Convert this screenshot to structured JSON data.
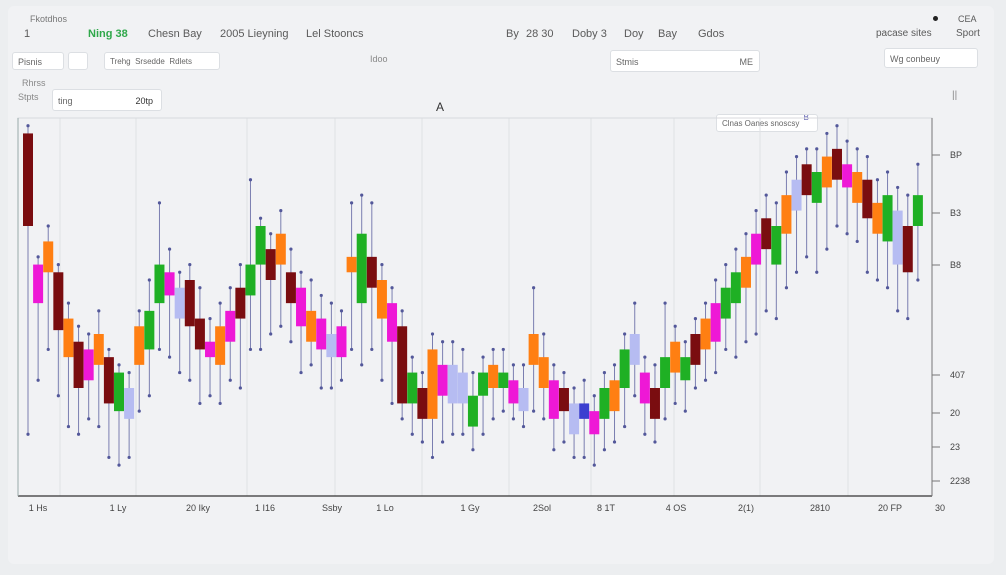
{
  "topbar": {
    "small_title": "Fkotdhos",
    "index": "1",
    "items": [
      "Ning 38",
      "Chesn Bay",
      "2005 Lieyning",
      "Lel Stooncs"
    ],
    "right_items": [
      "By",
      "28 30",
      "Doby 3",
      "Doy",
      "Bay",
      "Gdos"
    ],
    "far_right": [
      "CEA",
      "pacase sites",
      "Sport"
    ]
  },
  "toolbar": {
    "field1": "Pisnis",
    "field2": "",
    "field3": "Trehg",
    "field3b": "Srsedde",
    "field3c": "Rdlets",
    "center_label": "Idoo",
    "search_value": "Stmis",
    "search_suffix": "ME",
    "right_field": "Wg conbeuy",
    "sub1": "Rhrss",
    "sub2": "Stpts"
  },
  "chart_header": {
    "range_label": "ting",
    "range_value": "20tp",
    "marker": "A",
    "right_icon": "||",
    "legend_text": "Clnas Oanes snoscsy",
    "legend_icon": "B"
  },
  "colors": {
    "red": "#7a0d10",
    "orange": "#ff7f12",
    "green": "#1fb024",
    "magenta": "#ee18d6",
    "lightblue": "#b6bcf2",
    "wick": "#53589a"
  },
  "chart_data": {
    "type": "candlestick",
    "ylim": [
      2,
      100
    ],
    "y_ticks": [
      "BP",
      "B3",
      "B8",
      "407",
      "20",
      "23",
      "2238"
    ],
    "x_ticks": [
      "1 Hs",
      "1 Ly",
      "20 Iky",
      "1 I16",
      "Ssby",
      "1 Lo",
      "1 Gy",
      "2Sol",
      "8 1T",
      "4 OS",
      "2(1)",
      "2810",
      "20 FP",
      "30"
    ],
    "candles": [
      {
        "o": 96,
        "c": 72,
        "h": 98,
        "l": 18,
        "color": "red"
      },
      {
        "o": 62,
        "c": 52,
        "h": 64,
        "l": 32,
        "color": "magenta"
      },
      {
        "o": 68,
        "c": 60,
        "h": 72,
        "l": 40,
        "color": "orange"
      },
      {
        "o": 60,
        "c": 45,
        "h": 62,
        "l": 28,
        "color": "red"
      },
      {
        "o": 48,
        "c": 38,
        "h": 52,
        "l": 20,
        "color": "orange"
      },
      {
        "o": 42,
        "c": 30,
        "h": 46,
        "l": 18,
        "color": "red"
      },
      {
        "o": 40,
        "c": 32,
        "h": 44,
        "l": 22,
        "color": "magenta"
      },
      {
        "o": 44,
        "c": 36,
        "h": 50,
        "l": 20,
        "color": "orange"
      },
      {
        "o": 38,
        "c": 26,
        "h": 40,
        "l": 12,
        "color": "red"
      },
      {
        "o": 34,
        "c": 24,
        "h": 36,
        "l": 10,
        "color": "green"
      },
      {
        "o": 30,
        "c": 22,
        "h": 34,
        "l": 12,
        "color": "lightblue"
      },
      {
        "o": 46,
        "c": 36,
        "h": 50,
        "l": 24,
        "color": "orange"
      },
      {
        "o": 40,
        "c": 50,
        "h": 58,
        "l": 28,
        "color": "green"
      },
      {
        "o": 52,
        "c": 62,
        "h": 78,
        "l": 40,
        "color": "green"
      },
      {
        "o": 60,
        "c": 54,
        "h": 66,
        "l": 38,
        "color": "magenta"
      },
      {
        "o": 56,
        "c": 48,
        "h": 60,
        "l": 34,
        "color": "lightblue"
      },
      {
        "o": 58,
        "c": 46,
        "h": 62,
        "l": 32,
        "color": "red"
      },
      {
        "o": 48,
        "c": 40,
        "h": 56,
        "l": 26,
        "color": "red"
      },
      {
        "o": 42,
        "c": 38,
        "h": 48,
        "l": 28,
        "color": "magenta"
      },
      {
        "o": 46,
        "c": 36,
        "h": 52,
        "l": 26,
        "color": "orange"
      },
      {
        "o": 50,
        "c": 42,
        "h": 56,
        "l": 32,
        "color": "magenta"
      },
      {
        "o": 56,
        "c": 48,
        "h": 62,
        "l": 30,
        "color": "red"
      },
      {
        "o": 54,
        "c": 62,
        "h": 84,
        "l": 40,
        "color": "green"
      },
      {
        "o": 62,
        "c": 72,
        "h": 74,
        "l": 40,
        "color": "green"
      },
      {
        "o": 66,
        "c": 58,
        "h": 70,
        "l": 44,
        "color": "red"
      },
      {
        "o": 70,
        "c": 62,
        "h": 76,
        "l": 46,
        "color": "orange"
      },
      {
        "o": 60,
        "c": 52,
        "h": 66,
        "l": 42,
        "color": "red"
      },
      {
        "o": 56,
        "c": 46,
        "h": 60,
        "l": 34,
        "color": "magenta"
      },
      {
        "o": 50,
        "c": 42,
        "h": 58,
        "l": 36,
        "color": "orange"
      },
      {
        "o": 48,
        "c": 40,
        "h": 54,
        "l": 30,
        "color": "magenta"
      },
      {
        "o": 44,
        "c": 38,
        "h": 52,
        "l": 30,
        "color": "lightblue"
      },
      {
        "o": 46,
        "c": 38,
        "h": 50,
        "l": 32,
        "color": "magenta"
      },
      {
        "o": 60,
        "c": 64,
        "h": 78,
        "l": 40,
        "color": "orange"
      },
      {
        "o": 52,
        "c": 70,
        "h": 80,
        "l": 36,
        "color": "green"
      },
      {
        "o": 64,
        "c": 56,
        "h": 78,
        "l": 40,
        "color": "red"
      },
      {
        "o": 58,
        "c": 48,
        "h": 62,
        "l": 32,
        "color": "orange"
      },
      {
        "o": 52,
        "c": 42,
        "h": 56,
        "l": 26,
        "color": "magenta"
      },
      {
        "o": 46,
        "c": 26,
        "h": 50,
        "l": 22,
        "color": "red"
      },
      {
        "o": 34,
        "c": 26,
        "h": 38,
        "l": 18,
        "color": "green"
      },
      {
        "o": 30,
        "c": 22,
        "h": 34,
        "l": 16,
        "color": "red"
      },
      {
        "o": 40,
        "c": 22,
        "h": 44,
        "l": 12,
        "color": "orange"
      },
      {
        "o": 36,
        "c": 28,
        "h": 42,
        "l": 16,
        "color": "magenta"
      },
      {
        "o": 36,
        "c": 26,
        "h": 42,
        "l": 18,
        "color": "lightblue"
      },
      {
        "o": 34,
        "c": 26,
        "h": 40,
        "l": 18,
        "color": "lightblue"
      },
      {
        "o": 28,
        "c": 20,
        "h": 34,
        "l": 14,
        "color": "green"
      },
      {
        "o": 34,
        "c": 28,
        "h": 38,
        "l": 18,
        "color": "green"
      },
      {
        "o": 36,
        "c": 30,
        "h": 40,
        "l": 22,
        "color": "orange"
      },
      {
        "o": 34,
        "c": 30,
        "h": 40,
        "l": 24,
        "color": "green"
      },
      {
        "o": 32,
        "c": 26,
        "h": 36,
        "l": 22,
        "color": "magenta"
      },
      {
        "o": 30,
        "c": 24,
        "h": 36,
        "l": 20,
        "color": "lightblue"
      },
      {
        "o": 44,
        "c": 36,
        "h": 56,
        "l": 24,
        "color": "orange"
      },
      {
        "o": 38,
        "c": 30,
        "h": 44,
        "l": 22,
        "color": "orange"
      },
      {
        "o": 32,
        "c": 22,
        "h": 36,
        "l": 14,
        "color": "magenta"
      },
      {
        "o": 30,
        "c": 24,
        "h": 34,
        "l": 16,
        "color": "red"
      },
      {
        "o": 26,
        "c": 18,
        "h": 30,
        "l": 12,
        "color": "lightblue"
      },
      {
        "o": 22,
        "c": 26,
        "h": 32,
        "l": 12,
        "color": "blue"
      },
      {
        "o": 24,
        "c": 18,
        "h": 28,
        "l": 10,
        "color": "magenta"
      },
      {
        "o": 30,
        "c": 22,
        "h": 34,
        "l": 14,
        "color": "green"
      },
      {
        "o": 32,
        "c": 24,
        "h": 36,
        "l": 16,
        "color": "orange"
      },
      {
        "o": 40,
        "c": 30,
        "h": 44,
        "l": 20,
        "color": "green"
      },
      {
        "o": 44,
        "c": 36,
        "h": 52,
        "l": 28,
        "color": "lightblue"
      },
      {
        "o": 34,
        "c": 26,
        "h": 38,
        "l": 18,
        "color": "magenta"
      },
      {
        "o": 30,
        "c": 22,
        "h": 36,
        "l": 16,
        "color": "red"
      },
      {
        "o": 38,
        "c": 30,
        "h": 52,
        "l": 22,
        "color": "green"
      },
      {
        "o": 42,
        "c": 34,
        "h": 46,
        "l": 26,
        "color": "orange"
      },
      {
        "o": 38,
        "c": 32,
        "h": 42,
        "l": 24,
        "color": "green"
      },
      {
        "o": 44,
        "c": 36,
        "h": 48,
        "l": 30,
        "color": "red"
      },
      {
        "o": 48,
        "c": 40,
        "h": 52,
        "l": 32,
        "color": "orange"
      },
      {
        "o": 52,
        "c": 42,
        "h": 58,
        "l": 34,
        "color": "magenta"
      },
      {
        "o": 56,
        "c": 48,
        "h": 62,
        "l": 40,
        "color": "green"
      },
      {
        "o": 60,
        "c": 52,
        "h": 66,
        "l": 38,
        "color": "green"
      },
      {
        "o": 64,
        "c": 56,
        "h": 70,
        "l": 42,
        "color": "orange"
      },
      {
        "o": 70,
        "c": 62,
        "h": 76,
        "l": 44,
        "color": "magenta"
      },
      {
        "o": 74,
        "c": 66,
        "h": 80,
        "l": 50,
        "color": "red"
      },
      {
        "o": 72,
        "c": 62,
        "h": 78,
        "l": 48,
        "color": "green"
      },
      {
        "o": 80,
        "c": 70,
        "h": 86,
        "l": 56,
        "color": "orange"
      },
      {
        "o": 84,
        "c": 76,
        "h": 90,
        "l": 60,
        "color": "lightblue"
      },
      {
        "o": 88,
        "c": 80,
        "h": 92,
        "l": 64,
        "color": "red"
      },
      {
        "o": 86,
        "c": 78,
        "h": 92,
        "l": 60,
        "color": "green"
      },
      {
        "o": 90,
        "c": 82,
        "h": 96,
        "l": 66,
        "color": "orange"
      },
      {
        "o": 92,
        "c": 84,
        "h": 98,
        "l": 72,
        "color": "red"
      },
      {
        "o": 88,
        "c": 82,
        "h": 94,
        "l": 70,
        "color": "magenta"
      },
      {
        "o": 86,
        "c": 78,
        "h": 92,
        "l": 68,
        "color": "orange"
      },
      {
        "o": 84,
        "c": 74,
        "h": 90,
        "l": 60,
        "color": "red"
      },
      {
        "o": 78,
        "c": 70,
        "h": 84,
        "l": 58,
        "color": "orange"
      },
      {
        "o": 80,
        "c": 68,
        "h": 86,
        "l": 56,
        "color": "green"
      },
      {
        "o": 76,
        "c": 62,
        "h": 82,
        "l": 50,
        "color": "lightblue"
      },
      {
        "o": 72,
        "c": 60,
        "h": 80,
        "l": 48,
        "color": "red"
      },
      {
        "o": 80,
        "c": 72,
        "h": 88,
        "l": 58,
        "color": "green"
      }
    ]
  }
}
